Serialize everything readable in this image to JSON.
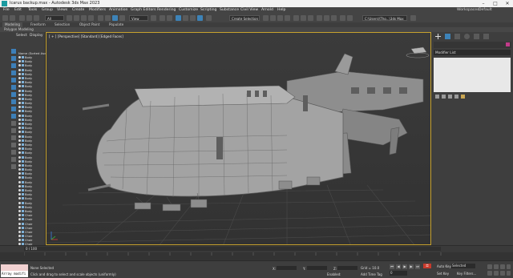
{
  "window": {
    "title": "Icarus backup.max - Autodesk 3ds Max 2023"
  },
  "menu": {
    "items": [
      "File",
      "Edit",
      "Tools",
      "Group",
      "Views",
      "Create",
      "Modifiers",
      "Animation",
      "Graph Editors",
      "Rendering",
      "Customize",
      "Scripting",
      "Substance",
      "Civil View",
      "Arnold",
      "Help"
    ],
    "workspaces_label": "Workspaces:",
    "workspace_value": "Default"
  },
  "toolbar": {
    "filter_value": "All",
    "view_value": "View",
    "selection_set": "Create Selection Se",
    "project_path": "C:\\Users\\\\Tho...\\3ds Max 2023"
  },
  "ribbon": {
    "tabs": [
      "Modeling",
      "Freeform",
      "Selection",
      "Object Paint",
      "Populate"
    ],
    "sub_label": "Polygon Modeling"
  },
  "scene_explorer": {
    "tabs": [
      "Select",
      "Display"
    ],
    "header": "Name (Sorted Ascending)",
    "rows": [
      "Body",
      "Body",
      "Body",
      "Body",
      "Body",
      "Body",
      "Body",
      "Body",
      "Body",
      "Body",
      "Body",
      "Body",
      "Body",
      "Body",
      "Body",
      "Body",
      "Body",
      "Body",
      "Body",
      "Body",
      "Body",
      "Body",
      "Body",
      "Body",
      "Body",
      "Body",
      "Body",
      "Body",
      "Body",
      "Body",
      "Body",
      "Body",
      "Body",
      "Body",
      "Body",
      "Body",
      "Body",
      "Body",
      "Chair",
      "Chair",
      "Chair",
      "Chair",
      "Chair",
      "Chair",
      "Chair",
      "Chair",
      "Chair",
      "Chair"
    ]
  },
  "viewport": {
    "label": "[ + ] [Perspective] [Standard] [Edged Faces]"
  },
  "command_panel": {
    "modifier_list": "Modifier List"
  },
  "timeline": {
    "frame_label": "0 / 100"
  },
  "status": {
    "maxscript_input": "Array modifi",
    "selection": "None Selected",
    "prompt": "Click and drag to select and scale objects (uniformly)",
    "x_label": "X:",
    "y_label": "Y:",
    "z_label": "Z:",
    "grid": "Grid = 10.0",
    "enabled": "Enabled:",
    "add_time_tag": "Add Time Tag",
    "auto_key": "Auto Key",
    "set_key": "Set Key",
    "selected": "Selected",
    "key_filters": "Key Filters...",
    "frame_value": "0"
  },
  "colors": {
    "accent": "#c7a22e",
    "tool_blue": "#3d83b8",
    "auto_key": "#c83a2c"
  }
}
